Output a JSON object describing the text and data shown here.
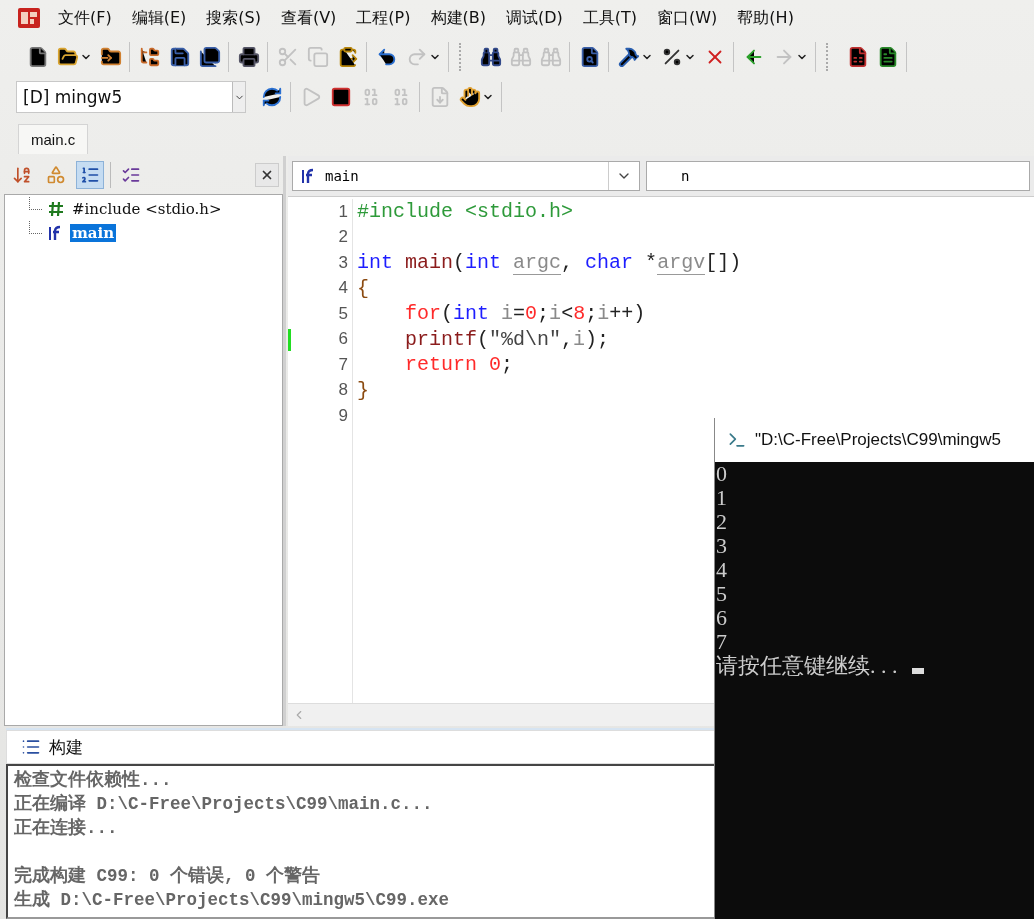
{
  "menu": [
    {
      "label": "文件(F)"
    },
    {
      "label": "编辑(E)"
    },
    {
      "label": "搜索(S)"
    },
    {
      "label": "查看(V)"
    },
    {
      "label": "工程(P)"
    },
    {
      "label": "构建(B)"
    },
    {
      "label": "调试(D)"
    },
    {
      "label": "工具(T)"
    },
    {
      "label": "窗口(W)"
    },
    {
      "label": "帮助(H)"
    }
  ],
  "toolbar": {
    "groups": [
      [
        {
          "disabled": false,
          "dropdown": false
        },
        {
          "disabled": false,
          "dropdown": true
        },
        {
          "disabled": false,
          "dropdown": false
        }
      ],
      [
        {
          "disabled": false,
          "dropdown": false
        },
        {
          "disabled": false,
          "dropdown": false
        },
        {
          "disabled": false,
          "dropdown": false
        }
      ],
      [
        {
          "disabled": false,
          "dropdown": false
        }
      ],
      [
        {
          "disabled": true,
          "dropdown": false
        },
        {
          "disabled": true,
          "dropdown": false
        },
        {
          "disabled": false,
          "dropdown": false
        }
      ],
      [
        {
          "disabled": false,
          "dropdown": false
        },
        {
          "disabled": true,
          "dropdown": true
        }
      ],
      [
        {
          "disabled": false,
          "dropdown": false
        },
        {
          "disabled": true,
          "dropdown": false
        },
        {
          "disabled": true,
          "dropdown": false
        }
      ],
      [
        {
          "disabled": false,
          "dropdown": false
        }
      ],
      [
        {
          "disabled": false,
          "dropdown": true
        },
        {
          "disabled": false,
          "dropdown": true
        },
        {
          "disabled": false,
          "dropdown": false
        }
      ],
      [
        {
          "disabled": false,
          "dropdown": false
        },
        {
          "disabled": true,
          "dropdown": true
        }
      ],
      [
        {
          "disabled": false,
          "dropdown": false
        },
        {
          "disabled": false,
          "dropdown": false
        }
      ]
    ]
  },
  "build_bar": {
    "config": "[D] mingw5",
    "groups": [
      [
        {
          "disabled": false,
          "dropdown": false
        }
      ],
      [
        {
          "disabled": true,
          "dropdown": false
        },
        {
          "disabled": false,
          "dropdown": false
        },
        {
          "disabled": true,
          "dropdown": false
        },
        {
          "disabled": true,
          "dropdown": false
        }
      ],
      [
        {
          "disabled": true,
          "dropdown": false
        },
        {
          "disabled": false,
          "dropdown": true
        }
      ]
    ]
  },
  "tabs": [
    {
      "label": "main.c",
      "selected": true
    }
  ],
  "symbols_panel": {
    "buttons": [
      {
        "pressed": false
      },
      {
        "pressed": false
      },
      {
        "pressed": true
      },
      {
        "pressed": false
      }
    ],
    "tree": [
      {
        "kind": "include",
        "label": "#include <stdio.h>",
        "selected": false
      },
      {
        "kind": "function",
        "label": "main",
        "selected": true
      }
    ]
  },
  "editor": {
    "function_combo": "main",
    "member_combo": "n",
    "lines": [
      {
        "number": "1",
        "changed": false,
        "tokens": [
          {
            "kind": "preproc",
            "text": "#include <stdio.h>"
          }
        ]
      },
      {
        "number": "2",
        "changed": false
      },
      {
        "number": "3",
        "changed": false,
        "tokens": [
          {
            "kind": "keyword",
            "text": "int"
          },
          {
            "kind": "func",
            "text": " main"
          },
          {
            "kind": "plain",
            "text": "("
          },
          {
            "kind": "keyword",
            "text": "int "
          },
          {
            "kind": "param",
            "text": "argc"
          },
          {
            "kind": "plain",
            "text": ", "
          },
          {
            "kind": "keyword",
            "text": "char"
          },
          {
            "kind": "plain",
            "text": " *"
          },
          {
            "kind": "param",
            "text": "argv"
          },
          {
            "kind": "plain",
            "text": "[])"
          }
        ]
      },
      {
        "number": "4",
        "changed": false,
        "tokens": [
          {
            "kind": "brace",
            "text": "{"
          }
        ]
      },
      {
        "number": "5",
        "changed": false,
        "tokens": [
          {
            "kind": "control",
            "text": "    for"
          },
          {
            "kind": "plain",
            "text": "("
          },
          {
            "kind": "keyword",
            "text": "int"
          },
          {
            "kind": "ident",
            "text": " i"
          },
          {
            "kind": "plain",
            "text": "="
          },
          {
            "kind": "number",
            "text": "0"
          },
          {
            "kind": "plain",
            "text": ";"
          },
          {
            "kind": "ident",
            "text": "i"
          },
          {
            "kind": "plain",
            "text": "<"
          },
          {
            "kind": "number",
            "text": "8"
          },
          {
            "kind": "plain",
            "text": ";"
          },
          {
            "kind": "ident",
            "text": "i"
          },
          {
            "kind": "plain",
            "text": "++)"
          }
        ]
      },
      {
        "number": "6",
        "changed": true,
        "tokens": [
          {
            "kind": "func",
            "text": "    printf"
          },
          {
            "kind": "plain",
            "text": "("
          },
          {
            "kind": "string",
            "text": "\"%d\\n\""
          },
          {
            "kind": "plain",
            "text": ","
          },
          {
            "kind": "ident",
            "text": "i"
          },
          {
            "kind": "plain",
            "text": ");"
          }
        ]
      },
      {
        "number": "7",
        "changed": false,
        "tokens": [
          {
            "kind": "control",
            "text": "    return"
          },
          {
            "kind": "number",
            "text": " 0"
          },
          {
            "kind": "plain",
            "text": ";"
          }
        ]
      },
      {
        "number": "8",
        "changed": false,
        "tokens": [
          {
            "kind": "brace",
            "text": "}"
          }
        ]
      },
      {
        "number": "9",
        "changed": false
      }
    ]
  },
  "build_panel": {
    "title": "构建",
    "lines": [
      {
        "text": "检查文件依赖性...",
        "gap_before": false
      },
      {
        "text": "正在编译 D:\\C-Free\\Projects\\C99\\main.c...",
        "gap_before": false
      },
      {
        "text": "正在连接...",
        "gap_before": false
      },
      {
        "text": "完成构建 C99: 0 个错误, 0 个警告",
        "gap_before": true
      },
      {
        "text": "生成 D:\\C-Free\\Projects\\C99\\mingw5\\C99.exe",
        "gap_before": false
      }
    ]
  },
  "console": {
    "title": "\"D:\\C-Free\\Projects\\C99\\mingw5",
    "lines": [
      "0",
      "1",
      "2",
      "3",
      "4",
      "5",
      "6",
      "7"
    ],
    "prompt": "请按任意键继续. . .",
    "cursor": true
  }
}
